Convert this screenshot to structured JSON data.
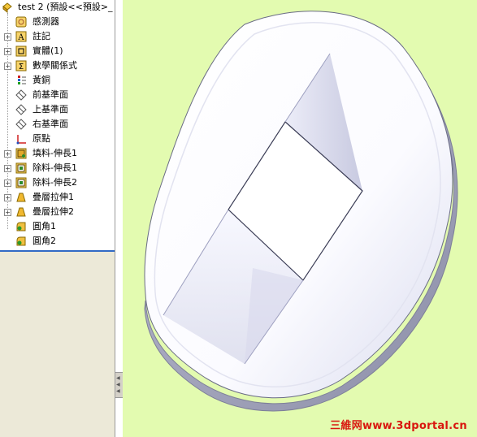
{
  "tree": {
    "root_label": "test 2 (預設<<預設>_",
    "items": [
      {
        "label": "感測器",
        "icon": "sensor-icon",
        "expandable": false
      },
      {
        "label": "註記",
        "icon": "annotation-icon",
        "expandable": true
      },
      {
        "label": "實體(1)",
        "icon": "solid-bodies-icon",
        "expandable": true
      },
      {
        "label": "數學關係式",
        "icon": "equations-icon",
        "expandable": true
      },
      {
        "label": "黃銅",
        "icon": "material-icon",
        "expandable": false
      },
      {
        "label": "前基準面",
        "icon": "plane-icon",
        "expandable": false
      },
      {
        "label": "上基準面",
        "icon": "plane-icon",
        "expandable": false
      },
      {
        "label": "右基準面",
        "icon": "plane-icon",
        "expandable": false
      },
      {
        "label": "原點",
        "icon": "origin-icon",
        "expandable": false
      },
      {
        "label": "填料-伸長1",
        "icon": "boss-extrude-icon",
        "expandable": true
      },
      {
        "label": "除料-伸長1",
        "icon": "cut-extrude-icon",
        "expandable": true
      },
      {
        "label": "除料-伸長2",
        "icon": "cut-extrude-icon",
        "expandable": true
      },
      {
        "label": "疊層拉伸1",
        "icon": "loft-icon",
        "expandable": true
      },
      {
        "label": "疊層拉伸2",
        "icon": "loft-icon",
        "expandable": true
      },
      {
        "label": "圓角1",
        "icon": "fillet-icon",
        "expandable": false
      },
      {
        "label": "圓角2",
        "icon": "fillet-icon",
        "expandable": false
      }
    ]
  },
  "viewport": {
    "background": "#e3fbb0",
    "model": "white-rounded-part-with-square-opening"
  },
  "watermark": "三維网www.3dportal.cn",
  "colors": {
    "selection_line": "#316ac5",
    "watermark": "#d9170f",
    "panel_bg": "#ece9d8"
  }
}
